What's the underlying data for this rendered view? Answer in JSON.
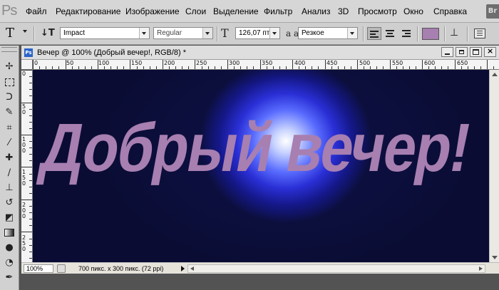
{
  "app": {
    "logo": "Ps",
    "bridge_label": "Br"
  },
  "menu": [
    "Файл",
    "Редактирование",
    "Изображение",
    "Слои",
    "Выделение",
    "Фильтр",
    "Анализ",
    "3D",
    "Просмотр",
    "Окно",
    "Справка"
  ],
  "options": {
    "tool_glyph": "T",
    "orientation_glyph": "↓T",
    "font_family": "Impact",
    "font_style": "Regular",
    "size_glyph": "T",
    "font_size": "126,07 пт",
    "aa_glyph": "a a",
    "antialias": "Резкое",
    "text_color": "#a77fb0",
    "warp_glyph": "⊥",
    "align_active": "left"
  },
  "document": {
    "title": "Вечер @ 100% (Добрый вечер!, RGB/8) *",
    "canvas_text": "Добрый вечер!",
    "text_color": "#a77fb0",
    "zoom": "100%",
    "status": "700 пикс. x 300 пикс. (72 ppi)"
  },
  "ruler": {
    "horizontal": [
      "0",
      "50",
      "100",
      "150",
      "200",
      "250",
      "300",
      "350",
      "400",
      "450",
      "500",
      "550",
      "600",
      "650"
    ],
    "vertical": [
      "0",
      "50",
      "100",
      "150",
      "200",
      "250"
    ]
  },
  "colors": {
    "canvas_dark": "#0c0f3e",
    "glow": "#2a2fd6"
  }
}
